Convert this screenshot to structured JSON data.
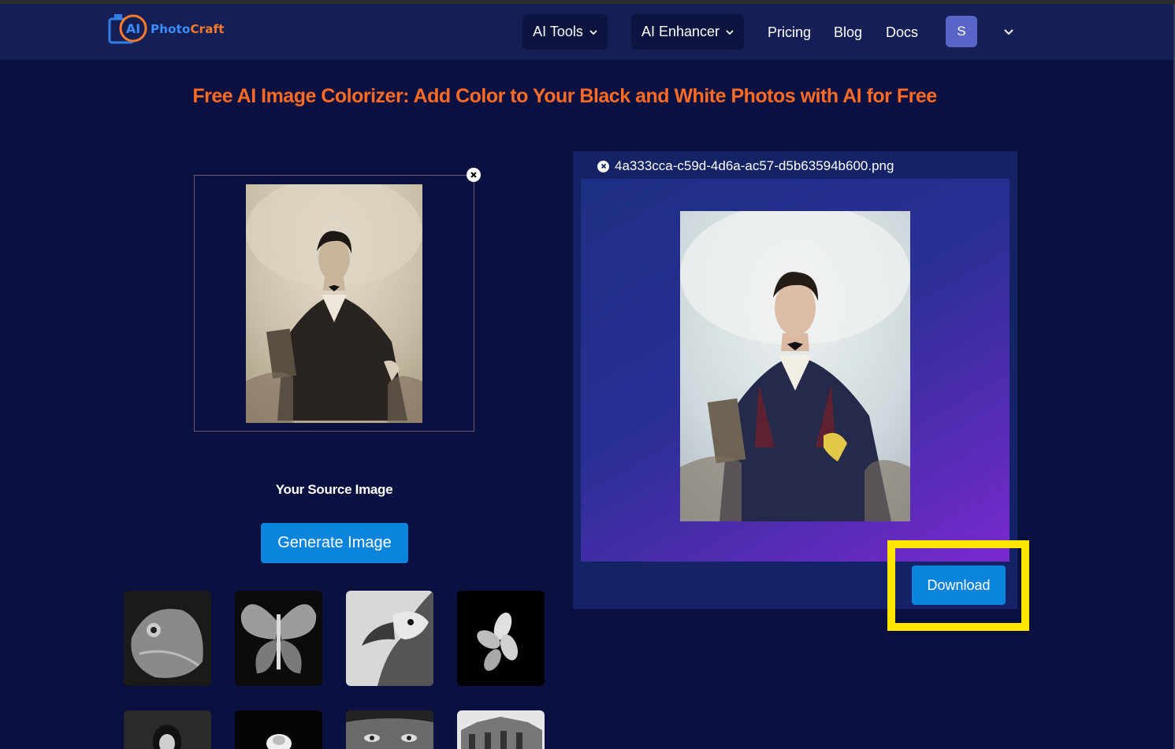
{
  "brand": {
    "logo_mark": "AI",
    "name_part1": "Photo",
    "name_part2": "Craft"
  },
  "nav": {
    "ai_tools": "AI Tools",
    "ai_enhancer": "AI Enhancer",
    "pricing": "Pricing",
    "blog": "Blog",
    "docs": "Docs",
    "avatar_initial": "S"
  },
  "page": {
    "headline": "Free AI Image Colorizer: Add Color to Your Black and White Photos with AI for Free"
  },
  "source": {
    "label": "Your Source Image",
    "generate_button": "Generate Image"
  },
  "result": {
    "filename": "4a333cca-c59d-4d6a-ac57-d5b63594b600.png",
    "download_button": "Download"
  },
  "colors": {
    "background": "#0a1140",
    "navbar": "#142055",
    "headline": "#ff6b24",
    "button": "#0a84dd",
    "highlight": "#ffe600"
  },
  "icons": [
    "chevron-down-icon",
    "close-icon",
    "sample-image-thumbnails"
  ]
}
